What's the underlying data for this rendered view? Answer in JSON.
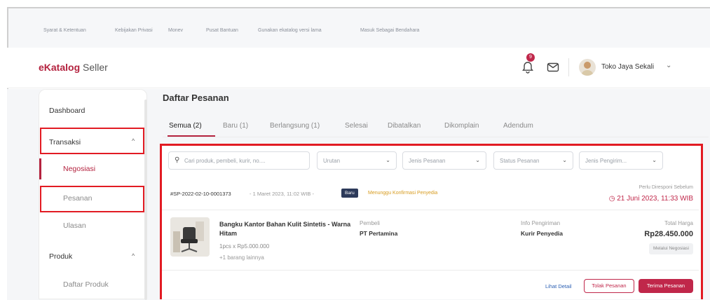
{
  "top_links": [
    "Syarat & Ketentuan",
    "Kebijakan Privasi",
    "Monev",
    "Pusat Bantuan",
    "Gunakan ekatalog versi lama",
    "Masuk Sebagai Bendahara"
  ],
  "header": {
    "logo_brand": "eKatalog",
    "logo_suffix": " Seller",
    "notification_count": "9",
    "user_name": "Toko Jaya Sekali",
    "icons": [
      "bell-icon",
      "mail-icon",
      "avatar",
      "chevron-down-icon"
    ]
  },
  "sidebar": {
    "dashboard": "Dashboard",
    "transaksi": "Transaksi",
    "negosiasi": "Negosiasi",
    "pesanan": "Pesanan",
    "ulasan": "Ulasan",
    "produk": "Produk",
    "daftar_produk": "Daftar Produk"
  },
  "page": {
    "title": "Daftar Pesanan",
    "tabs": [
      "Semua (2)",
      "Baru (1)",
      "Berlangsung (1)",
      "Selesai",
      "Dibatalkan",
      "Dikomplain",
      "Adendum"
    ]
  },
  "filters": {
    "search_placeholder": "Cari produk, pembeli, kurir, no....",
    "urutan": "Urutan",
    "jenis_pesanan": "Jenis Pesanan",
    "status_pesanan": "Status Pesanan",
    "jenis_pengiriman": "Jenis Pengirim..."
  },
  "order": {
    "id": "#SP-2022-02-10-0001373",
    "date": "- 1 Maret 2023, 11:02 WIB -",
    "badge": "Baru",
    "status": "Menunggu Konfirmasi Penyedia",
    "deadline_label": "Perlu Diresponi Sebelum",
    "deadline": "21 Juni 2023, 11:33 WIB",
    "product_name": "Bangku Kantor Bahan Kulit Sintetis - Warna Hitam",
    "qty": "1pcs x Rp5.000.000",
    "more": "+1 barang lainnya",
    "buyer_label": "Pembeli",
    "buyer": "PT Pertamina",
    "shipping_label": "Info Pengiriman",
    "shipping": "Kurir Penyedia",
    "total_label": "Total Harga",
    "total": "Rp28.450.000",
    "method": "Melalui Negosiasi",
    "btn_detail": "Lihat Detail",
    "btn_reject": "Tolak Pesanan",
    "btn_accept": "Terima Pesanan"
  },
  "colors": {
    "accent": "#b4233f",
    "highlight": "#e21b23",
    "pending": "#d79b1e",
    "link": "#2b5fb3"
  }
}
